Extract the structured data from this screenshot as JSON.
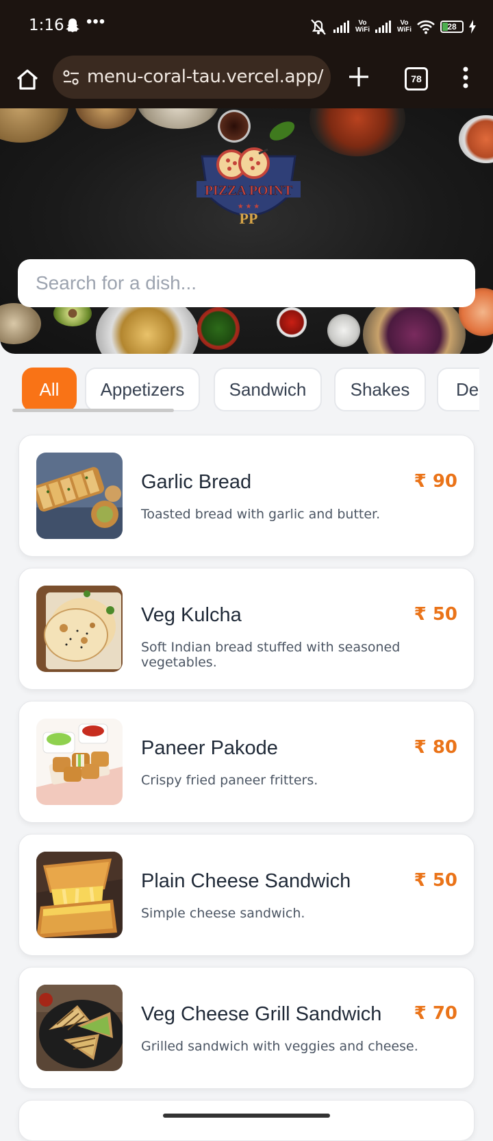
{
  "status_bar": {
    "time": "1:16",
    "battery": "28",
    "wifi_label_1": "Vo\nWiFi",
    "wifi_label_2": "Vo\nWiFi"
  },
  "browser": {
    "url": "menu-coral-tau.vercel.app/m",
    "tab_count": "78"
  },
  "search": {
    "placeholder": "Search for a dish..."
  },
  "categories": [
    "All",
    "Appetizers",
    "Sandwich",
    "Shakes",
    "Des"
  ],
  "active_category": "All",
  "currency": "₹",
  "items": [
    {
      "name": "Garlic Bread",
      "description": "Toasted bread with garlic and butter.",
      "price": "₹ 90"
    },
    {
      "name": "Veg Kulcha",
      "description": "Soft Indian bread stuffed with seasoned vegetables.",
      "price": "₹ 50"
    },
    {
      "name": "Paneer Pakode",
      "description": "Crispy fried paneer fritters.",
      "price": "₹ 80"
    },
    {
      "name": "Plain Cheese Sandwich",
      "description": "Simple cheese sandwich.",
      "price": "₹ 50"
    },
    {
      "name": "Veg Cheese Grill Sandwich",
      "description": "Grilled sandwich with veggies and cheese.",
      "price": "₹ 70"
    }
  ],
  "colors": {
    "accent": "#f97316",
    "price": "#ea7318",
    "browser_bar": "#1c1410"
  },
  "logo": {
    "text": "PIZZA POINT",
    "monogram": "PP"
  }
}
